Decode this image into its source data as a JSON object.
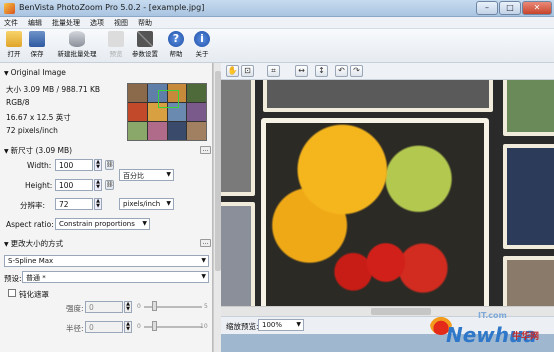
{
  "window": {
    "title": "BenVista PhotoZoom Pro 5.0.2 - [example.jpg]",
    "min": "–",
    "max": "□",
    "close": "✕"
  },
  "menu": [
    "文件",
    "编辑",
    "批量处理",
    "选项",
    "视图",
    "帮助"
  ],
  "toolbar": {
    "open": "打开",
    "save": "保存",
    "new_batch": "新建批量处理",
    "preview": "预览",
    "settings": "参数设置",
    "help": "帮助",
    "about": "关于"
  },
  "original_image": {
    "header": "Original Image",
    "size": "大小 3.09 MB / 988.71 KB",
    "mode": "RGB/8",
    "dimensions": "16.67 x 12.5 英寸",
    "resolution": "72 pixels/inch"
  },
  "new_size": {
    "header": "新尺寸 (3.09 MB)",
    "width_label": "Width:",
    "width_value": "100",
    "height_label": "Height:",
    "height_value": "100",
    "unit": "百分比",
    "resolution_label": "分辨率:",
    "resolution_value": "72",
    "resolution_unit": "pixels/inch",
    "aspect_label": "Aspect ratio:",
    "aspect_value": "Constrain proportions"
  },
  "resize_method": {
    "header": "更改大小的方式",
    "method": "S-Spline Max",
    "preset_label": "预设:",
    "preset_value": "普通 *",
    "sharpen_label": "钝化遮罩",
    "strength_label": "强度:",
    "strength_value": "0",
    "strength_min": "0",
    "strength_max": "5",
    "radius_label": "半径:",
    "radius_value": "0",
    "radius_min": "0",
    "radius_max": "10"
  },
  "status": {
    "zoom_label": "缩放预览:",
    "zoom_value": "100%"
  },
  "watermark": {
    "brand": "Newhua",
    "site": "牛华网",
    "sub": "IT.com"
  },
  "colors": {
    "accent": "#2f77c8",
    "title_bar": "#a9c4e1",
    "panel": "#f4f4f4"
  }
}
